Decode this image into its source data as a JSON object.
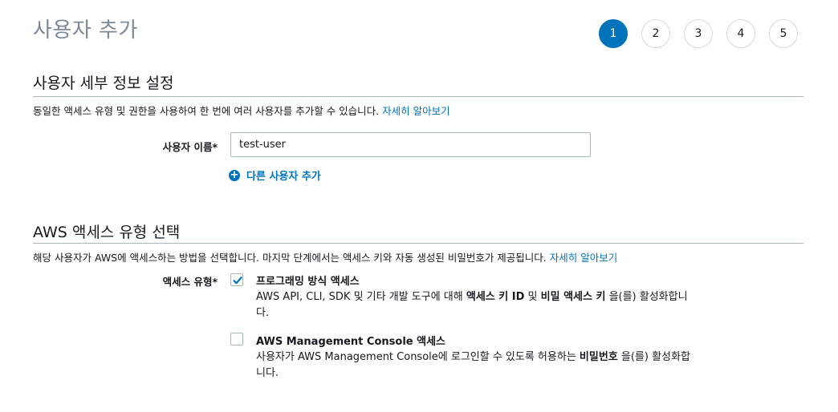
{
  "header": {
    "title": "사용자 추가"
  },
  "steps": [
    "1",
    "2",
    "3",
    "4",
    "5"
  ],
  "details": {
    "section_title": "사용자 세부 정보 설정",
    "description": "동일한 액세스 유형 및 권한을 사용하여 한 번에 여러 사용자를 추가할 수 있습니다.",
    "learn_more": "자세히 알아보기",
    "username_label": "사용자 이름*",
    "username_value": "test-user",
    "add_user_label": "다른 사용자 추가"
  },
  "access": {
    "section_title": "AWS 액세스 유형 선택",
    "description": "해당 사용자가 AWS에 액세스하는 방법을 선택합니다. 마지막 단계에서는 액세스 키와 자동 생성된 비밀번호가 제공됩니다.",
    "learn_more": "자세히 알아보기",
    "type_label": "액세스 유형*",
    "options": [
      {
        "title": "프로그래밍 방식 액세스",
        "checked": true,
        "desc_parts": [
          "AWS API, CLI, SDK 및 기타 개발 도구에 대해 ",
          "액세스 키 ID",
          " 및 ",
          "비밀 액세스 키",
          " 을(를) 활성화합니다."
        ]
      },
      {
        "title": "AWS Management Console 액세스",
        "checked": false,
        "desc_parts": [
          "사용자가 AWS Management Console에 로그인할 수 있도록 허용하는 ",
          "비밀번호",
          " 을(를) 활성화합니다."
        ]
      }
    ]
  },
  "colors": {
    "accent": "#0073bb",
    "muted_title": "#7d8998",
    "rule": "#aab7b8"
  }
}
